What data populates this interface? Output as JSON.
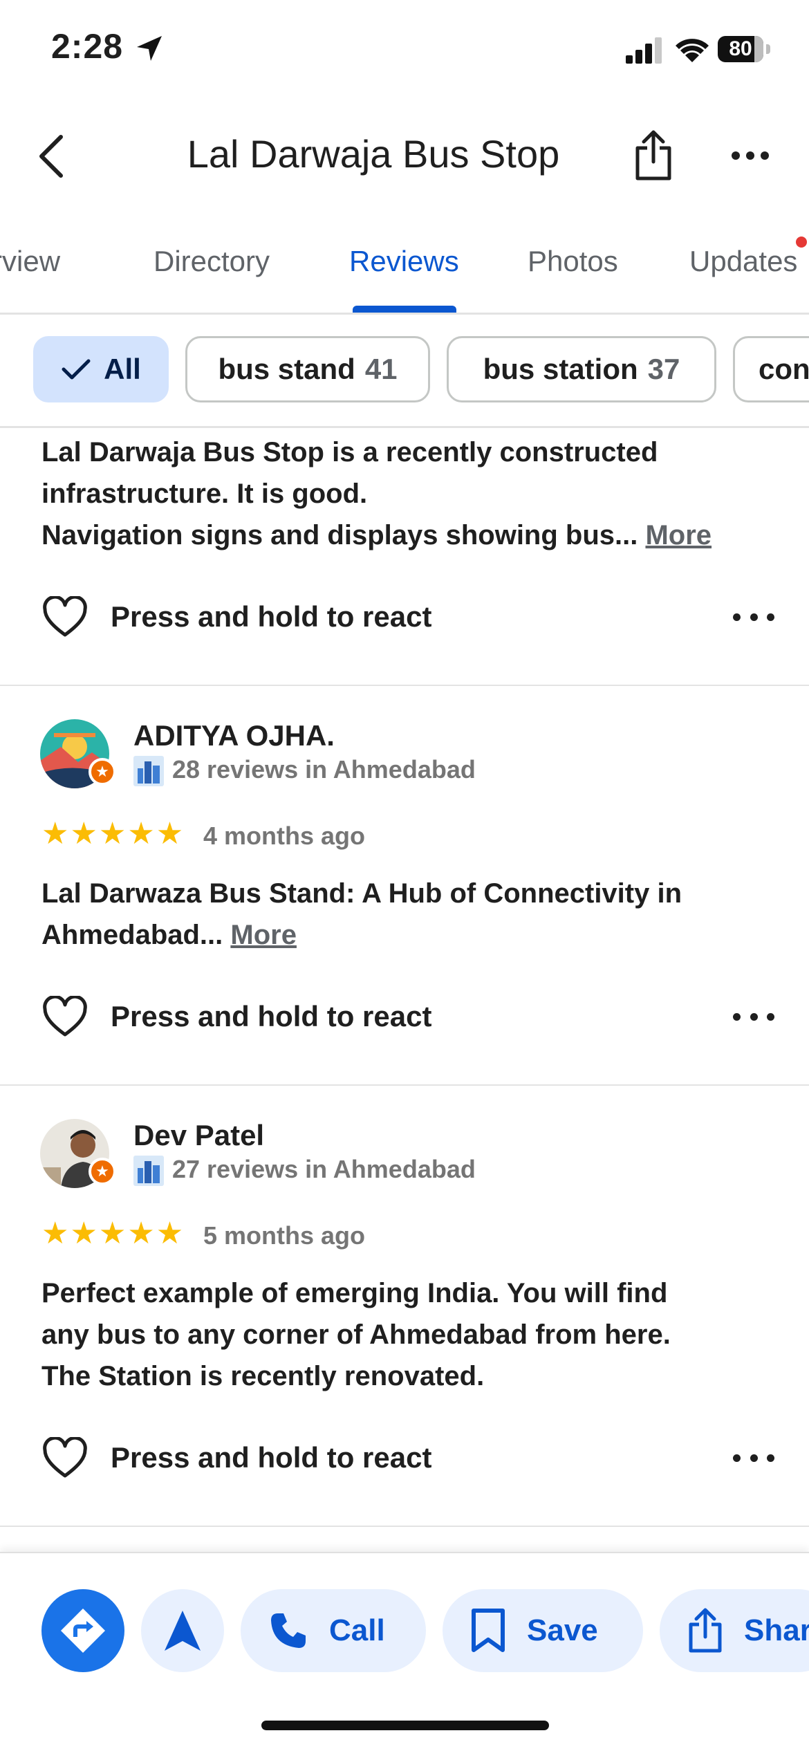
{
  "status_bar": {
    "time": "2:28",
    "battery": "80",
    "battery_level": 0.8
  },
  "header": {
    "title": "Lal Darwaja Bus Stop"
  },
  "tabs": [
    {
      "label": "Overview"
    },
    {
      "label": "Directory"
    },
    {
      "label": "Reviews"
    },
    {
      "label": "Photos"
    },
    {
      "label": "Updates"
    }
  ],
  "active_tab": "Reviews",
  "chips": [
    {
      "label": "All",
      "count": ""
    },
    {
      "label": "bus stand",
      "count": "41"
    },
    {
      "label": "bus station",
      "count": "37"
    },
    {
      "label": "con",
      "count": ""
    }
  ],
  "reviews": [
    {
      "text_lines": [
        "Lal Darwaja Bus Stop is a recently constructed",
        "infrastructure. It is good.",
        "Navigation signs and displays showing bus... "
      ],
      "more": "More",
      "react_label": "Press and hold to react"
    },
    {
      "name": "ADITYA OJHA.",
      "meta": "28 reviews in Ahmedabad",
      "stars": "★★★★★",
      "rating": 5,
      "when": "4 months ago",
      "text_lines": [
        "Lal Darwaza Bus Stand: A Hub of Connectivity in",
        "Ahmedabad... "
      ],
      "more": "More",
      "react_label": "Press and hold to react"
    },
    {
      "name": "Dev Patel",
      "meta": "27 reviews in Ahmedabad",
      "stars": "★★★★★",
      "rating": 5,
      "when": "5 months ago",
      "text_lines": [
        "Perfect example of emerging India. You will find",
        "any bus to any corner of Ahmedabad from here.",
        "The Station is recently renovated."
      ],
      "react_label": "Press and hold to react"
    }
  ],
  "bottom_bar": {
    "call_label": "Call",
    "save_label": "Save",
    "share_label": "Share"
  },
  "colors": {
    "accent": "#0b57d0",
    "directions": "#1a73e8",
    "star": "#fbbc04",
    "badge": "#ef6c00"
  }
}
